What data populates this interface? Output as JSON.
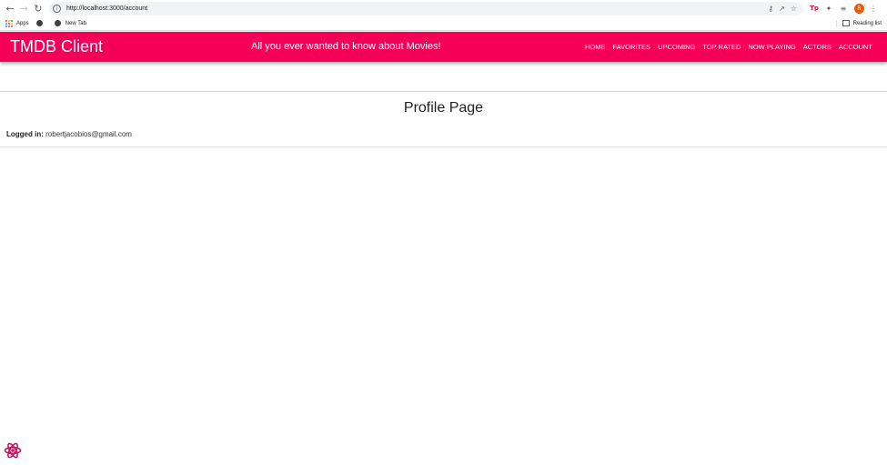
{
  "browser": {
    "url": "http://localhost:3000/account",
    "bookmarks": {
      "apps_label": "Apps",
      "new_tab_label": "New Tab",
      "reading_list_label": "Reading list"
    },
    "profile_initial": "R",
    "extension_label": "Tp"
  },
  "header": {
    "brand": "TMDB Client",
    "tagline": "All you ever wanted to know about Movies!",
    "nav": [
      "HOME",
      "FAVORITES",
      "UPCOMING",
      "TOP RATED",
      "NOW PLAYING",
      "ACTORS",
      "ACCOUNT"
    ],
    "color": "#f50057"
  },
  "main": {
    "title": "Profile Page",
    "logged_in_label": "Logged in:",
    "email": "robertjacobios@gmail.com"
  },
  "icons": [
    "back-arrow-icon",
    "forward-arrow-icon",
    "reload-icon",
    "info-icon",
    "key-icon",
    "share-icon",
    "star-icon",
    "extensions-icon",
    "media-icon",
    "menu-dots-icon",
    "react-devtools-icon"
  ]
}
